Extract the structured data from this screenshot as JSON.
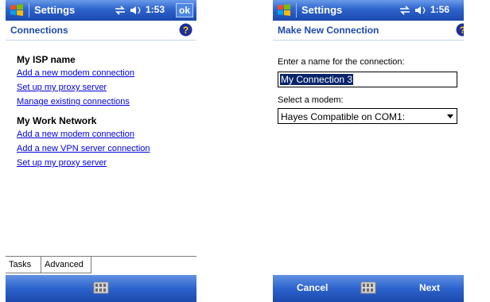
{
  "screen1": {
    "title_bar": {
      "app": "Settings",
      "time": "1:53",
      "ok_label": "ok"
    },
    "header": "Connections",
    "groups": [
      {
        "title": "My ISP name",
        "links": [
          "Add a new modem connection",
          "Set up my proxy server",
          "Manage existing connections"
        ]
      },
      {
        "title": "My Work Network",
        "links": [
          "Add a new modem connection",
          "Add a new VPN server connection",
          "Set up my proxy server"
        ]
      }
    ],
    "tabs": [
      "Tasks",
      "Advanced"
    ]
  },
  "screen2": {
    "title_bar": {
      "app": "Settings",
      "time": "1:56"
    },
    "header": "Make New Connection",
    "name_label": "Enter a name for the connection:",
    "name_value": "My Connection 3",
    "modem_label": "Select a modem:",
    "modem_value": "Hayes Compatible on COM1:",
    "softkeys": {
      "left": "Cancel",
      "right": "Next"
    }
  },
  "colors": {
    "titlebar": "#2d63cc",
    "header_text": "#1c4aae",
    "link": "#0000dd",
    "selection": "#0a246a"
  },
  "icons": [
    "windows-start-icon",
    "connectivity-icon",
    "volume-icon",
    "help-icon",
    "keyboard-icon",
    "dropdown-arrow-icon"
  ]
}
